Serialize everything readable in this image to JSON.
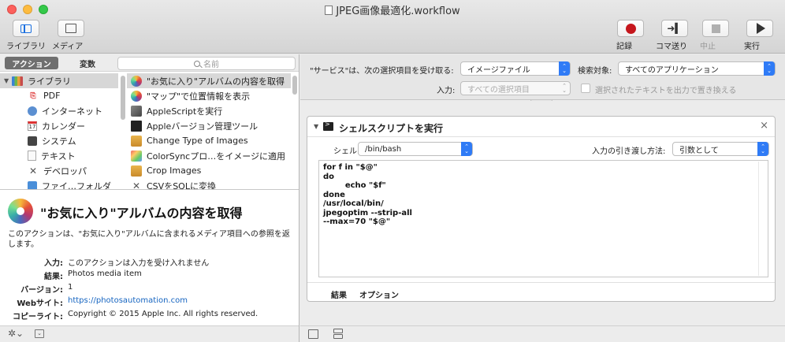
{
  "window": {
    "title": "JPEG画像最適化.workflow"
  },
  "toolbar": {
    "library_label": "ライブラリ",
    "media_label": "メディア",
    "record_label": "記録",
    "step_label": "コマ送り",
    "stop_label": "中止",
    "run_label": "実行"
  },
  "left": {
    "tab_actions": "アクション",
    "tab_variables": "変数",
    "search_placeholder": "名前",
    "library_items": [
      {
        "label": "ライブラリ",
        "icon": "library-icon"
      },
      {
        "label": "PDF",
        "icon": "pdf-icon"
      },
      {
        "label": "インターネット",
        "icon": "globe-icon"
      },
      {
        "label": "カレンダー",
        "icon": "calendar-icon"
      },
      {
        "label": "システム",
        "icon": "system-icon"
      },
      {
        "label": "テキスト",
        "icon": "text-icon"
      },
      {
        "label": "デベロッパ",
        "icon": "developer-tools-icon"
      },
      {
        "label": "ファイ…フォルダ",
        "icon": "finder-icon"
      }
    ],
    "actions": [
      {
        "label": "\"お気に入り\"アルバムの内容を取得",
        "icon": "photos-icon"
      },
      {
        "label": "\"マップ\"で位置情報を表示",
        "icon": "photos-icon"
      },
      {
        "label": "AppleScriptを実行",
        "icon": "script-icon"
      },
      {
        "label": "Appleバージョン管理ツール",
        "icon": "terminal-icon"
      },
      {
        "label": "Change Type of Images",
        "icon": "preview-icon"
      },
      {
        "label": "ColorSyncプロ…をイメージに適用",
        "icon": "colorsync-icon"
      },
      {
        "label": "Crop Images",
        "icon": "preview-icon"
      },
      {
        "label": "CSVをSQLに変換",
        "icon": "developer-tools-icon"
      }
    ]
  },
  "description": {
    "title": "\"お気に入り\"アルバムの内容を取得",
    "body": "このアクションは、\"お気に入り\"アルバムに含まれるメディア項目への参照を返します。",
    "meta": [
      {
        "key": "入力:",
        "value": "このアクションは入力を受け入れません"
      },
      {
        "key": "結果:",
        "value": "Photos media item"
      },
      {
        "key": "バージョン:",
        "value": "1"
      },
      {
        "key": "Webサイト:",
        "value": "https://photosautomation.com"
      },
      {
        "key": "コピーライト:",
        "value": "Copyright © 2015 Apple Inc. All rights reserved."
      }
    ]
  },
  "service": {
    "receives_label": "\"サービス\"は、次の選択項目を受け取る:",
    "receives_value": "イメージファイル",
    "in_label": "検索対象:",
    "in_value": "すべてのアプリケーション",
    "input_label": "入力:",
    "input_value": "すべての選択項目",
    "replace_label": "選択されたテキストを出力で置き換える"
  },
  "action_card": {
    "title": "シェルスクリプトを実行",
    "shell_label": "シェル:",
    "shell_value": "/bin/bash",
    "pass_input_label": "入力の引き渡し方法:",
    "pass_input_value": "引数として",
    "script": "for f in \"$@\"\ndo\n        echo \"$f\"\ndone\n/usr/local/bin/\njpegoptim --strip-all\n--max=70 \"$@\"",
    "tab_results": "結果",
    "tab_options": "オプション"
  },
  "colors": {
    "accent": "#2f7bf6",
    "record": "#c5161c",
    "link": "#1564c0"
  }
}
